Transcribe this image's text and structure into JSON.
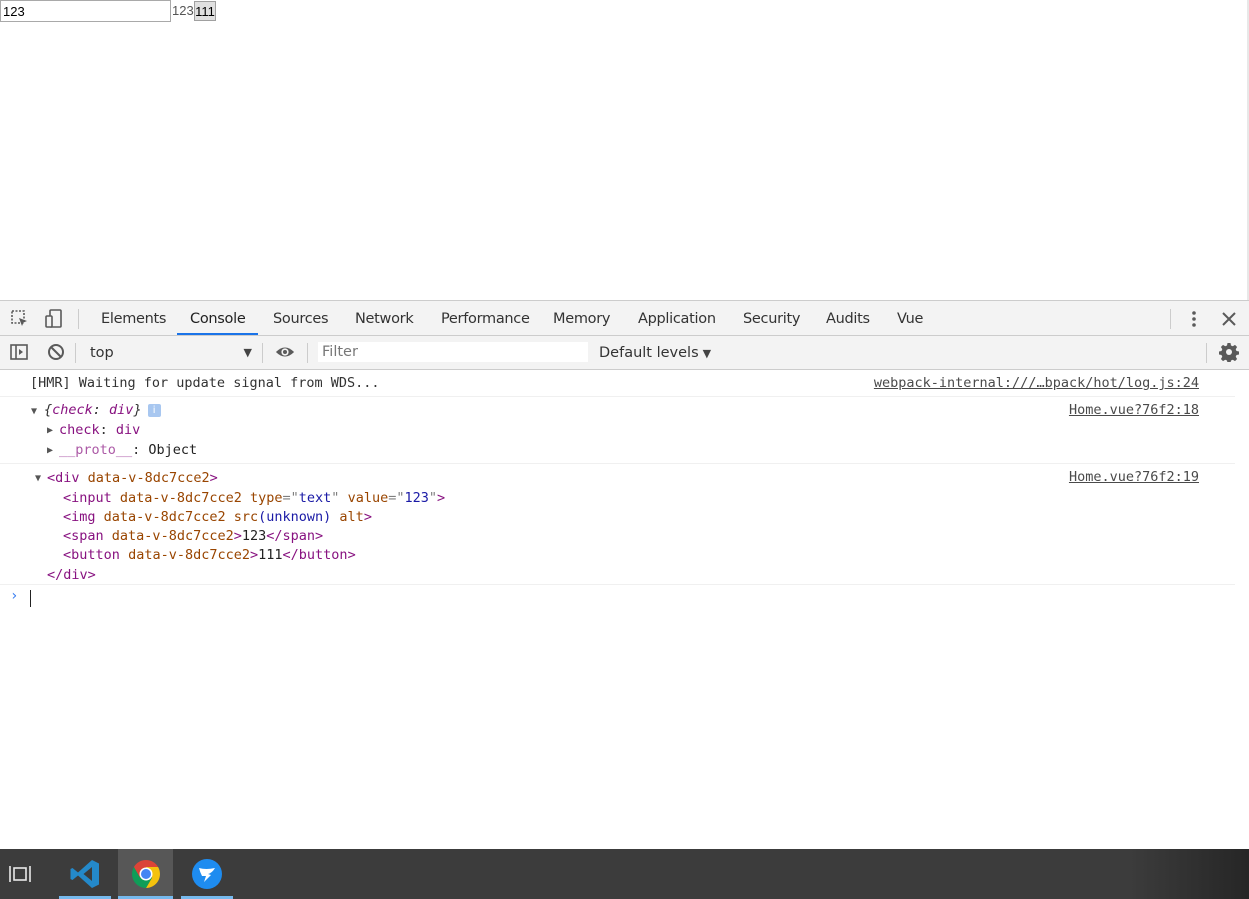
{
  "page": {
    "input_value": "123",
    "span_text": "123",
    "button_label": "111"
  },
  "devtools": {
    "tabs": [
      {
        "label": "Elements"
      },
      {
        "label": "Console",
        "active": true
      },
      {
        "label": "Sources"
      },
      {
        "label": "Network"
      },
      {
        "label": "Performance"
      },
      {
        "label": "Memory"
      },
      {
        "label": "Application"
      },
      {
        "label": "Security"
      },
      {
        "label": "Audits"
      },
      {
        "label": "Vue"
      }
    ],
    "toolbar": {
      "context": "top",
      "filter_placeholder": "Filter",
      "levels": "Default levels"
    },
    "console": {
      "hmr": {
        "text": "[HMR] Waiting for update signal from WDS...",
        "source": "webpack-internal:///…bpack/hot/log.js:24"
      },
      "object": {
        "summary_open": "{",
        "key": "check",
        "sep": ": ",
        "value": "div",
        "summary_close": "}",
        "badge": "i",
        "prop1_key": "check",
        "prop1_value": "div",
        "prop2_key": "__proto__",
        "prop2_value": "Object",
        "source": "Home.vue?76f2:18"
      },
      "element": {
        "source": "Home.vue?76f2:19",
        "open_tag": "div",
        "open_attr": "data-v-8dc7cce2",
        "input_tag": "input",
        "input_attr": "data-v-8dc7cce2",
        "input_type_name": "type",
        "input_type_value": "text",
        "input_value_name": "value",
        "input_value_value": "123",
        "img_tag": "img",
        "img_attr": "data-v-8dc7cce2",
        "img_src": "src",
        "img_unknown": "(unknown)",
        "img_alt": "alt",
        "span_tag": "span",
        "span_attr": "data-v-8dc7cce2",
        "span_text": "123",
        "span_close": "span",
        "button_tag": "button",
        "button_attr": "data-v-8dc7cce2",
        "button_text": "111",
        "button_close": "button",
        "close_tag": "div"
      }
    }
  },
  "taskbar": {
    "apps": [
      "task-view-icon",
      "vscode-icon",
      "chrome-icon",
      "dingtalk-icon"
    ],
    "colors": {
      "vscode": "#2489ca",
      "chrome_red": "#db4437",
      "chrome_yellow": "#f4c20d",
      "chrome_green": "#0f9d58",
      "chrome_blue": "#4285f4",
      "dingtalk": "#1e8cf0"
    }
  }
}
